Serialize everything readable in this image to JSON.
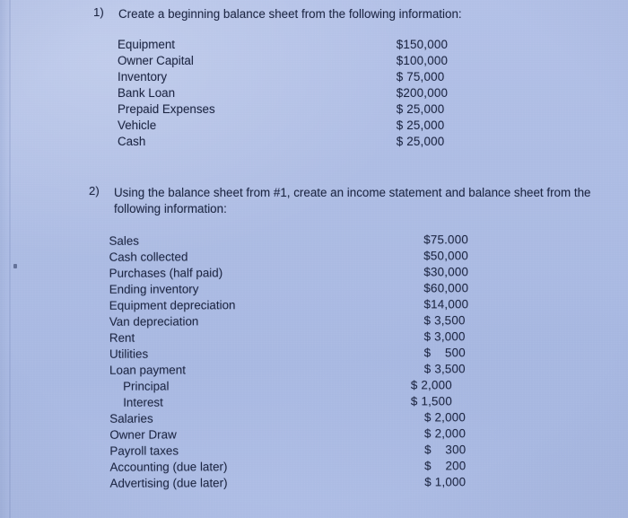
{
  "document": {
    "type": "handwritten-scan-worksheet",
    "background_color": "#aebde4",
    "text_color": "#1c2542"
  },
  "questions": [
    {
      "number": "1)",
      "prompt": "Create a beginning balance sheet from the following information:",
      "items": [
        {
          "label": "Equipment",
          "value": "$150,000"
        },
        {
          "label": "Owner Capital",
          "value": "$100,000"
        },
        {
          "label": "Inventory",
          "value": "$ 75,000"
        },
        {
          "label": "Bank Loan",
          "value": "$200,000"
        },
        {
          "label": "Prepaid Expenses",
          "value": "$ 25,000"
        },
        {
          "label": "Vehicle",
          "value": "$ 25,000"
        },
        {
          "label": "Cash",
          "value": "$ 25,000"
        }
      ]
    },
    {
      "number": "2)",
      "prompt": "Using the balance sheet from #1, create an income statement and balance sheet from the following information:",
      "items": [
        {
          "label": "Sales",
          "value": "$75.000",
          "indent": false
        },
        {
          "label": "Cash collected",
          "value": "$50,000",
          "indent": false
        },
        {
          "label": "Purchases (half paid)",
          "value": "$30,000",
          "indent": false
        },
        {
          "label": "Ending inventory",
          "value": "$60,000",
          "indent": false
        },
        {
          "label": "Equipment depreciation",
          "value": "$14,000",
          "indent": false
        },
        {
          "label": "Van depreciation",
          "value": "$ 3,500",
          "indent": false
        },
        {
          "label": "Rent",
          "value": "$ 3,000",
          "indent": false
        },
        {
          "label": "Utilities",
          "value": "$    500",
          "indent": false
        },
        {
          "label": "Loan payment",
          "value": "$ 3,500",
          "indent": false
        },
        {
          "label": "Principal",
          "value": "$ 2,000",
          "indent": true
        },
        {
          "label": "Interest",
          "value": "$ 1,500",
          "indent": true
        },
        {
          "label": "Salaries",
          "value": "$ 2,000",
          "indent": false
        },
        {
          "label": "Owner Draw",
          "value": "$ 2,000",
          "indent": false
        },
        {
          "label": "Payroll taxes",
          "value": "$    300",
          "indent": false
        },
        {
          "label": "Accounting (due later)",
          "value": "$    200",
          "indent": false
        },
        {
          "label": "Advertising (due later)",
          "value": "$ 1,000",
          "indent": false
        }
      ]
    }
  ]
}
